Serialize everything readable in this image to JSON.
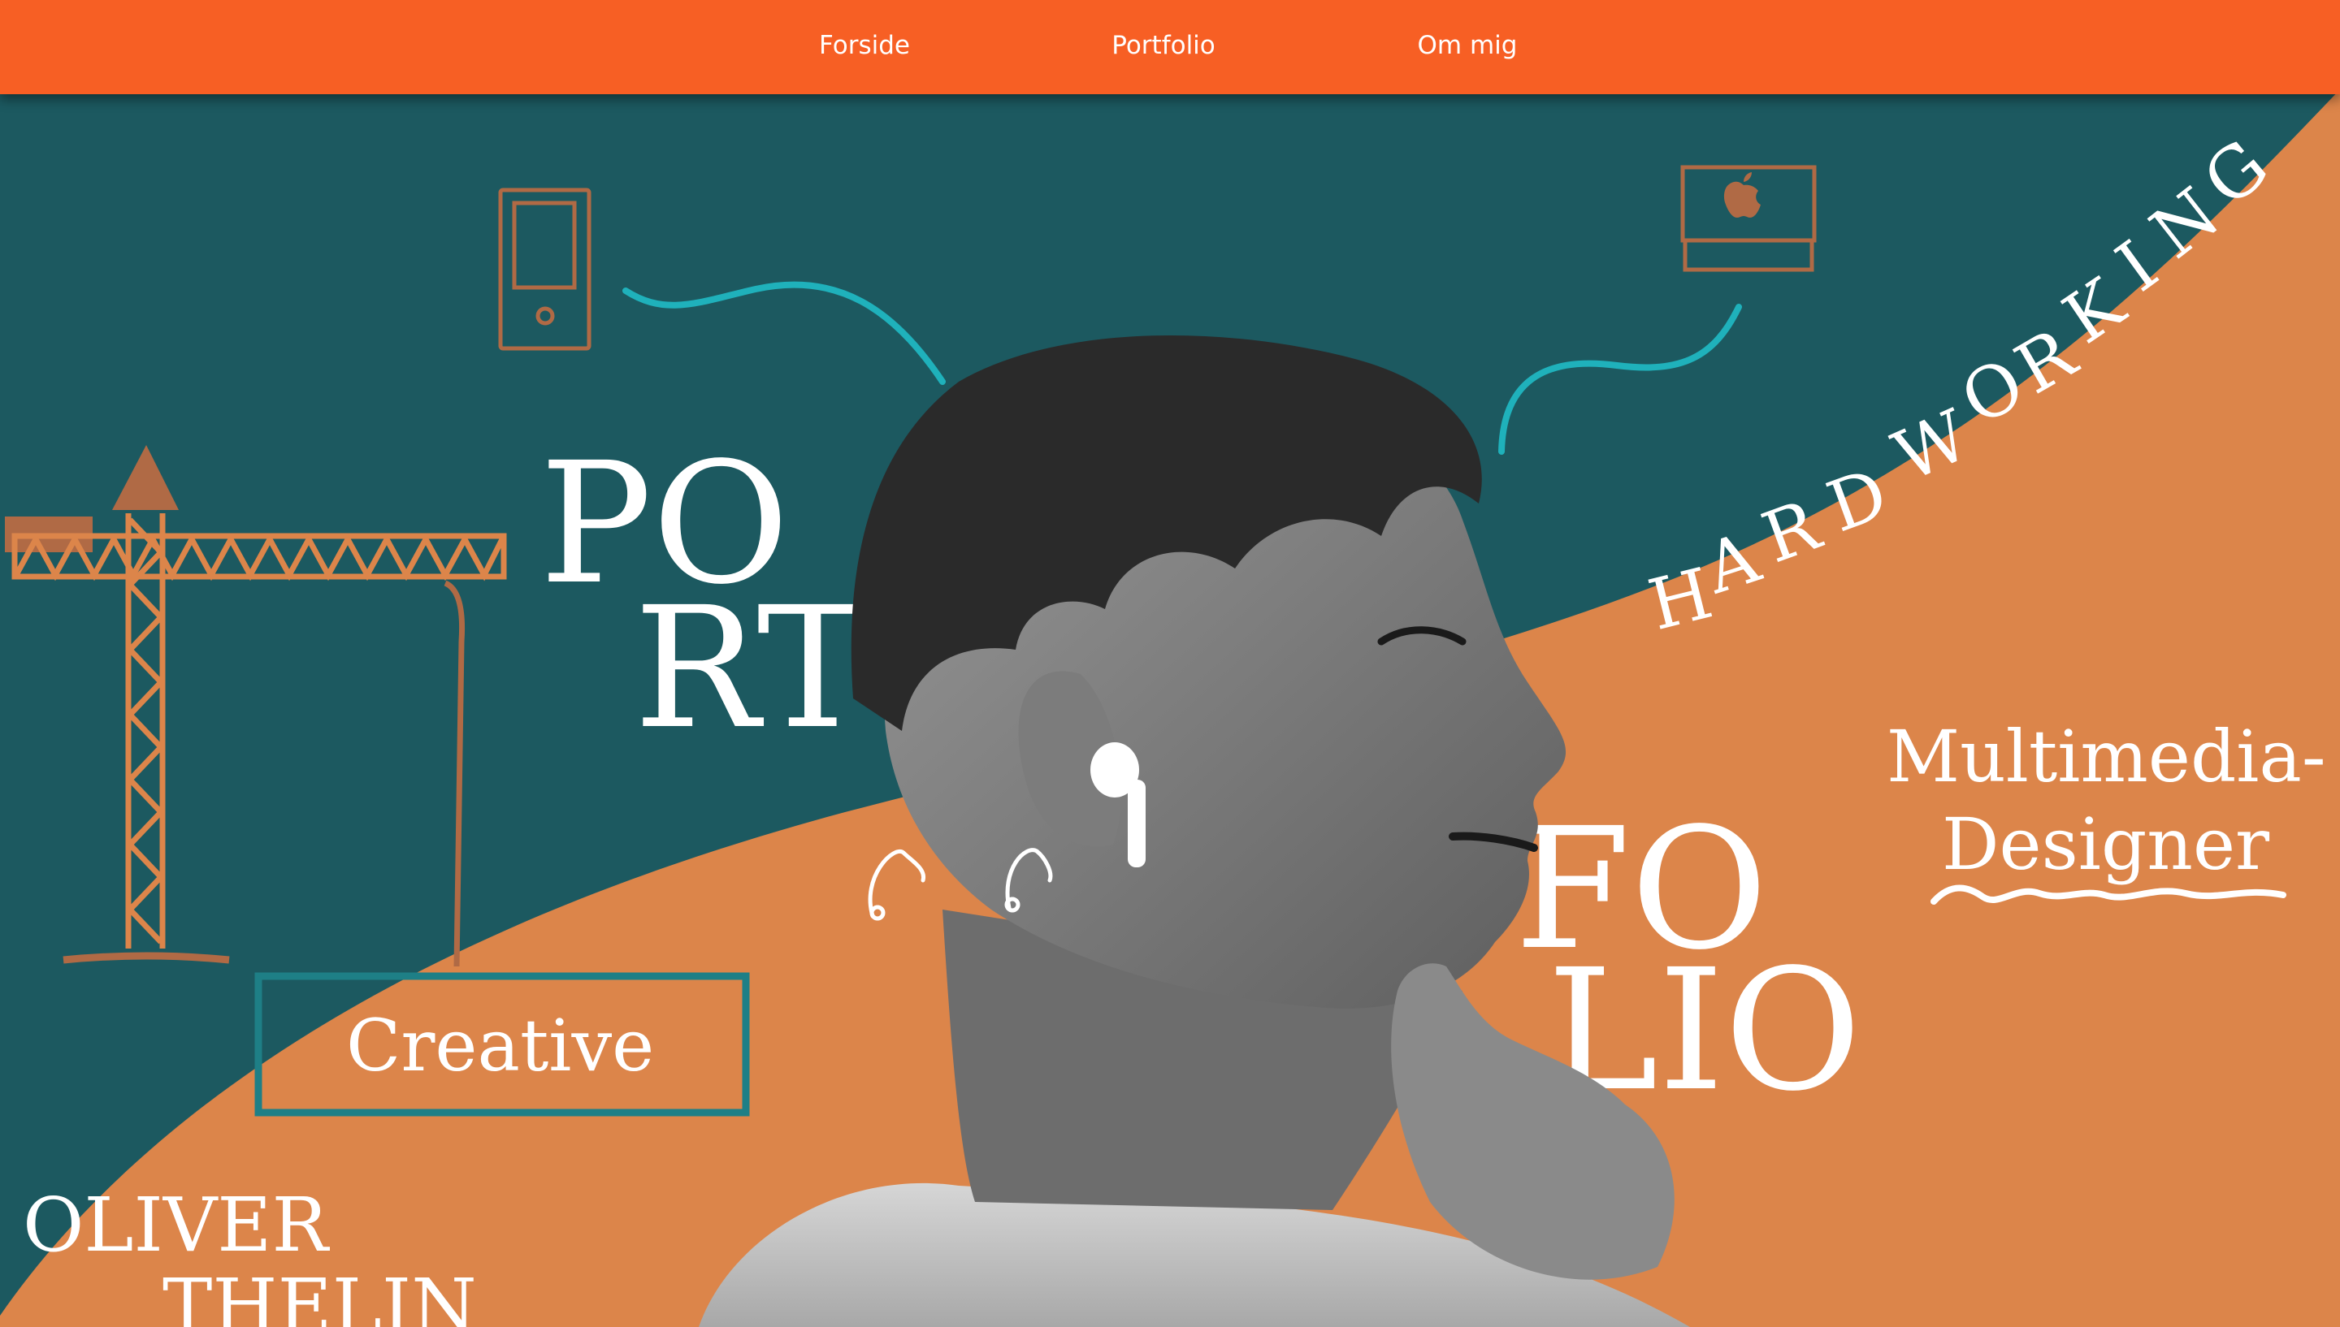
{
  "nav": {
    "items": [
      {
        "label": "Forside"
      },
      {
        "label": "Portfolio"
      },
      {
        "label": "Om mig"
      }
    ]
  },
  "hero": {
    "portfolio_top": "PO",
    "portfolio_mid": "RT",
    "portfolio_right_top": "FO",
    "portfolio_right_bottom": "LIO",
    "hard_letters": [
      "H",
      "A",
      "R",
      "D"
    ],
    "working_letters": [
      "W",
      "O",
      "R",
      "K",
      "I",
      "N",
      "G"
    ],
    "subtitle_line1": "Multimedia-",
    "subtitle_line2": "Designer",
    "creative_label": "Creative",
    "name_first": "OLIVER",
    "name_last": "THELIN"
  },
  "colors": {
    "nav": "#f75f24",
    "teal_bg": "#1c5960",
    "orange_bg": "#dc854a",
    "doodle_brown": "#b06a45",
    "doodle_cyan": "#1fb1bb",
    "creative_border": "#1e7f86"
  },
  "icons": [
    "phone-doodle-icon",
    "crane-doodle-icon",
    "computer-doodle-icon",
    "apple-logo-icon",
    "music-note-icon"
  ]
}
